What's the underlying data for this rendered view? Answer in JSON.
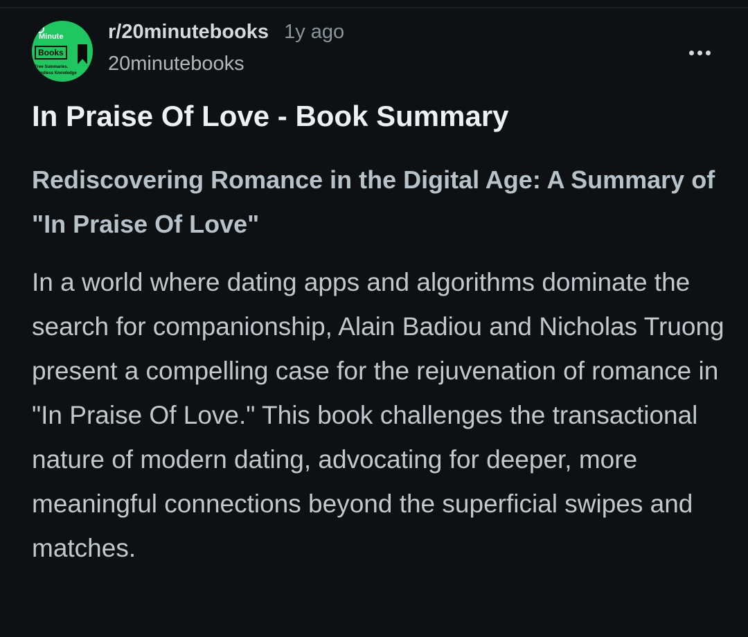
{
  "post": {
    "subreddit": "r/20minutebooks",
    "age": "1y ago",
    "username": "20minutebooks",
    "title": "In Praise Of Love - Book Summary",
    "heading": "Rediscovering Romance in the Digital Age: A Summary of \"In Praise Of Love\"",
    "body": "In a world where dating apps and algorithms dominate the search for companionship, Alain Badiou and Nicholas Truong present a compelling case for the rejuvenation of romance in \"In Praise Of Love.\" This book challenges the transactional nature of modern dating, advocating for deeper, more meaningful connections beyond the superficial swipes and matches."
  },
  "avatar": {
    "line1": "Minute",
    "line2": "Books",
    "line3": "Free Summaries.",
    "line4": "Endless Knowledge",
    "color": "#1ec75f"
  },
  "icons": {
    "more": "more-options-icon"
  }
}
